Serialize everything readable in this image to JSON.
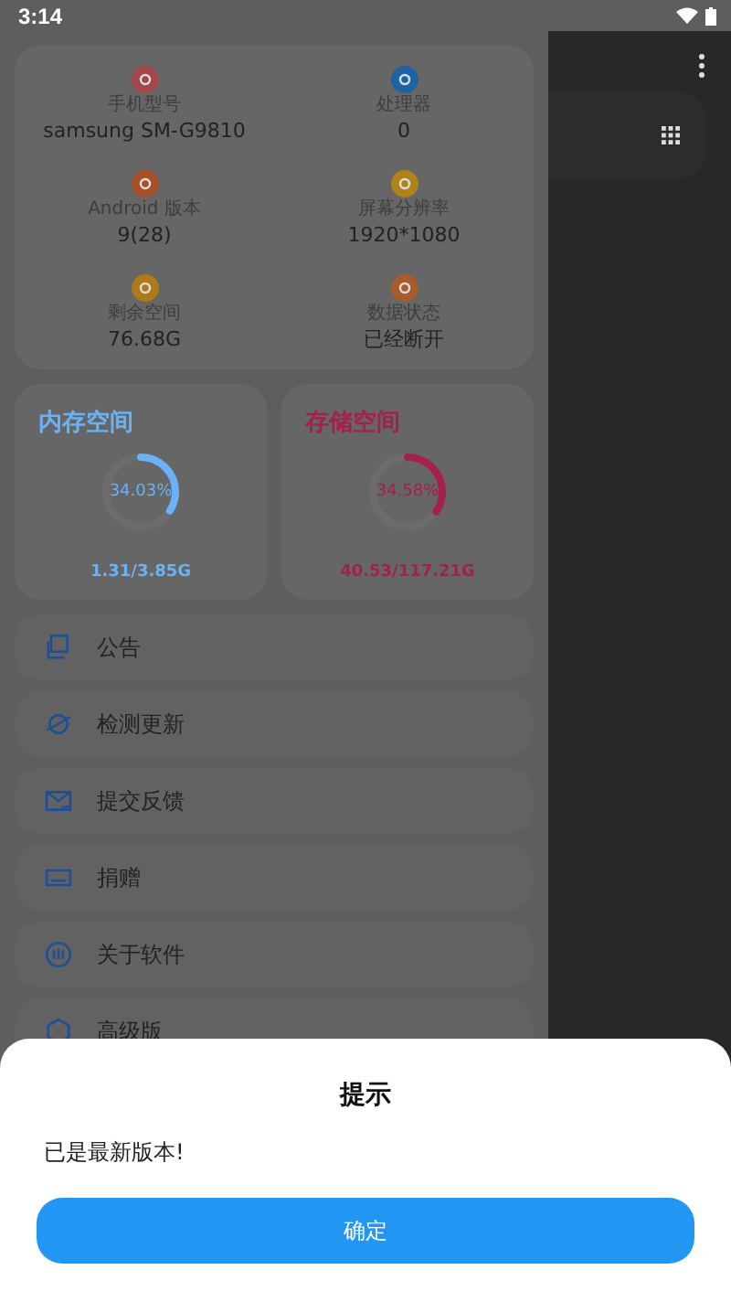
{
  "status_bar": {
    "time": "3:14"
  },
  "device_info": [
    {
      "label": "手机型号",
      "value": "samsung SM-G9810",
      "color": "#a34848"
    },
    {
      "label": "处理器",
      "value": "0",
      "color": "#1d63a4"
    },
    {
      "label": "Android 版本",
      "value": "9(28)",
      "color": "#a8502a"
    },
    {
      "label": "屏幕分辨率",
      "value": "1920*1080",
      "color": "#b0821a"
    },
    {
      "label": "剩余空间",
      "value": "76.68G",
      "color": "#b07a18"
    },
    {
      "label": "数据状态",
      "value": "已经断开",
      "color": "#a85c2a"
    }
  ],
  "storage_cards": [
    {
      "title": "内存空间",
      "percent": "34.03%",
      "level": 0.3403,
      "usage": "1.31/3.85G",
      "color": "#6ab2f5"
    },
    {
      "title": "存储空间",
      "percent": "34.58%",
      "level": 0.3458,
      "usage": "40.53/117.21G",
      "color": "#a3204f"
    }
  ],
  "menu": [
    {
      "label": "公告",
      "kind": "notice"
    },
    {
      "label": "检测更新",
      "kind": "update"
    },
    {
      "label": "提交反馈",
      "kind": "feedback"
    },
    {
      "label": "捐赠",
      "kind": "donate"
    },
    {
      "label": "关于软件",
      "kind": "about"
    },
    {
      "label": "高级版",
      "kind": "premium"
    }
  ],
  "dialog": {
    "title": "提示",
    "message": "已是最新版本!",
    "button": "确定"
  }
}
